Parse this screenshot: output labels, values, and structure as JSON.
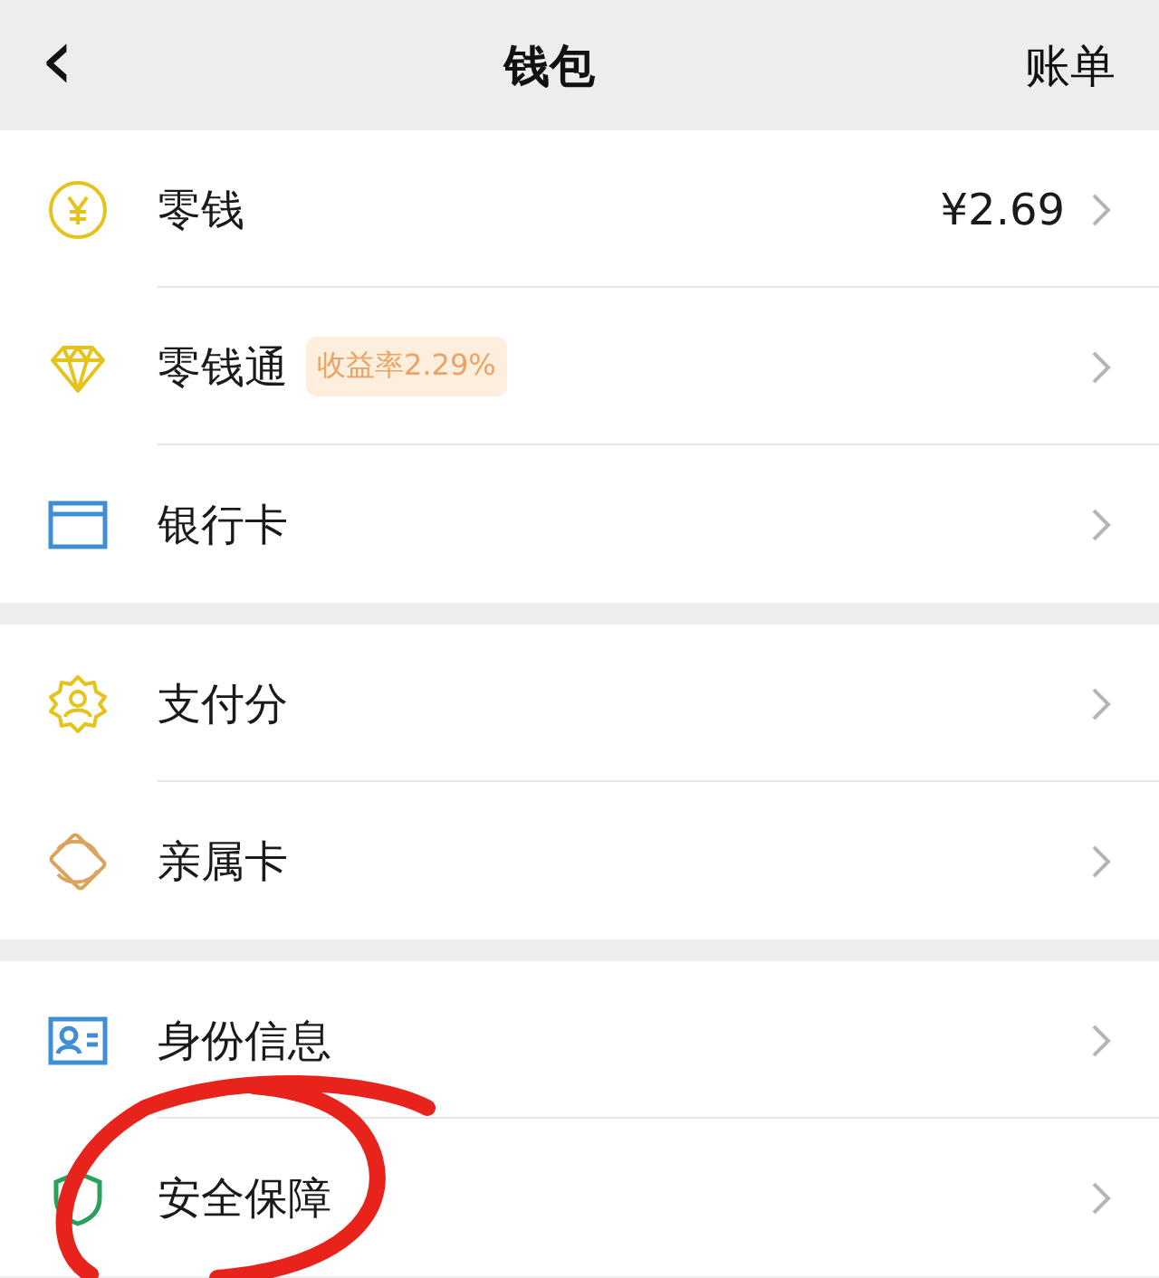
{
  "header": {
    "back": "‹",
    "title": "钱包",
    "action": "账单"
  },
  "groups": [
    {
      "items": [
        {
          "kind": "coin",
          "label": "零钱",
          "value": "¥2.69"
        },
        {
          "kind": "diamond",
          "label": "零钱通",
          "badge": "收益率2.29%"
        },
        {
          "kind": "card",
          "label": "银行卡"
        }
      ]
    },
    {
      "items": [
        {
          "kind": "seal",
          "label": "支付分"
        },
        {
          "kind": "cards",
          "label": "亲属卡"
        }
      ]
    },
    {
      "items": [
        {
          "kind": "id",
          "label": "身份信息"
        },
        {
          "kind": "shield",
          "label": "安全保障"
        }
      ]
    }
  ]
}
